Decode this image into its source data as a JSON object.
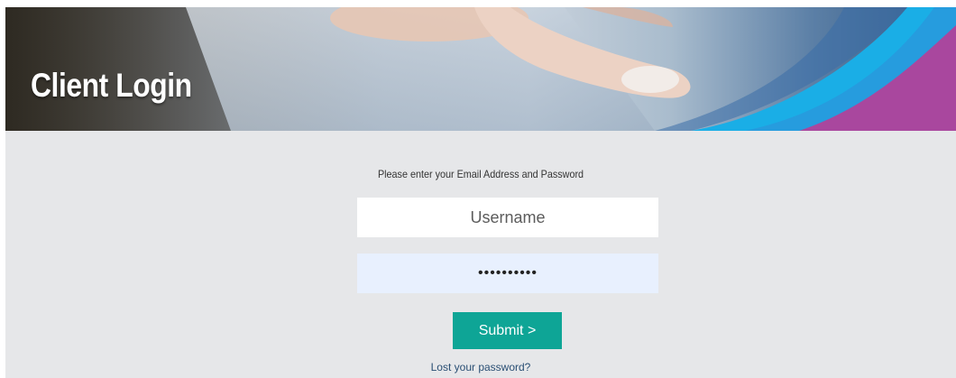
{
  "header": {
    "title": "Client Login"
  },
  "form": {
    "instructions": "Please enter your Email Address and Password",
    "username_placeholder": "Username",
    "password_value": "••••••••••",
    "submit_label": "Submit >",
    "lost_password_link": "Lost your password?"
  },
  "colors": {
    "panel_background": "#e6e7e9",
    "submit_background": "#0ea596",
    "password_field_background": "#e8f0fe",
    "link": "#2a4f74",
    "accent_cyan": "#1aaee6",
    "accent_magenta": "#a9479e"
  }
}
